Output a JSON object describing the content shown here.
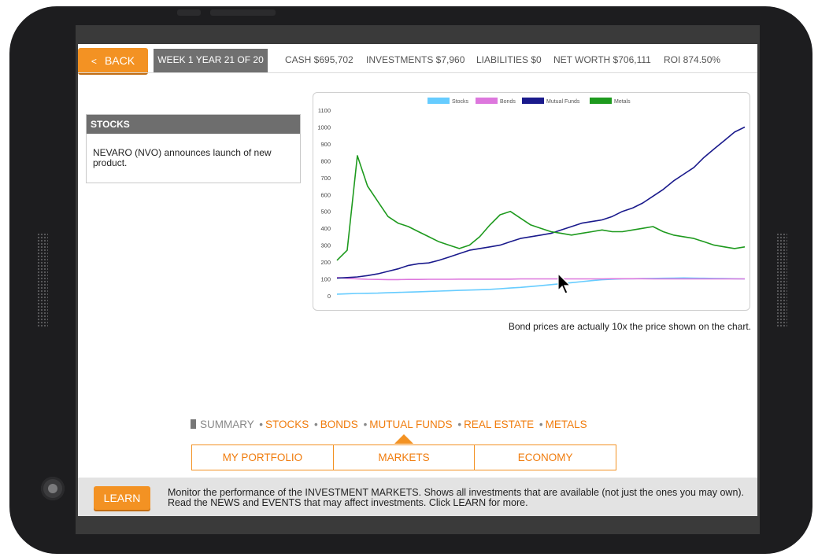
{
  "header": {
    "back_label": "BACK",
    "week_label": "WEEK 1 YEAR 21 OF 20",
    "stats": [
      "CASH $695,702",
      "INVESTMENTS $7,960",
      "LIABILITIES $0",
      "NET WORTH $706,111",
      "ROI 874.50%"
    ]
  },
  "news": {
    "title": "STOCKS",
    "text": "NEVARO (NVO) announces launch of new product."
  },
  "chart_note": "Bond prices are actually 10x the price shown on the chart.",
  "market_nav": {
    "current": "SUMMARY",
    "links": [
      "STOCKS",
      "BONDS",
      "MUTUAL FUNDS",
      "REAL ESTATE",
      "METALS"
    ]
  },
  "tabs": [
    "MY PORTFOLIO",
    "MARKETS",
    "ECONOMY"
  ],
  "footer": {
    "learn_label": "LEARN",
    "text": "Monitor the performance of the INVESTMENT MARKETS. Shows all investments that are available (not just the ones you may own). Read the NEWS and EVENTS that may affect investments. Click LEARN for more."
  },
  "colors": {
    "accent": "#f39223",
    "stocks": "#66ccff",
    "bonds": "#dd77dd",
    "mutual_funds": "#1a1a8c",
    "metals": "#1e9a1e"
  },
  "chart_data": {
    "type": "line",
    "ylim": [
      0,
      1100
    ],
    "yticks": [
      0,
      100,
      200,
      300,
      400,
      500,
      600,
      700,
      800,
      900,
      1000,
      1100
    ],
    "legend_position": "top",
    "grid": false,
    "series": [
      {
        "name": "Stocks",
        "color": "#66ccff",
        "values": [
          10,
          12,
          14,
          15,
          16,
          18,
          20,
          22,
          24,
          26,
          28,
          30,
          32,
          34,
          36,
          38,
          42,
          46,
          50,
          55,
          60,
          66,
          72,
          78,
          84,
          90,
          95,
          98,
          100,
          101,
          102,
          103,
          104,
          105,
          106,
          105,
          104,
          103,
          102,
          101,
          100
        ]
      },
      {
        "name": "Bonds",
        "color": "#dd77dd",
        "values": [
          108,
          104,
          100,
          98,
          97,
          96,
          96,
          97,
          97,
          98,
          98,
          98,
          99,
          99,
          99,
          99,
          99,
          99,
          100,
          100,
          100,
          100,
          100,
          100,
          100,
          100,
          100,
          101,
          101,
          101,
          101,
          100,
          100,
          100,
          100,
          100,
          100,
          100,
          100,
          100,
          100
        ]
      },
      {
        "name": "Mutual Funds",
        "color": "#1a1a8c",
        "values": [
          105,
          108,
          112,
          120,
          130,
          145,
          160,
          180,
          190,
          195,
          210,
          230,
          250,
          270,
          280,
          290,
          300,
          320,
          340,
          350,
          360,
          370,
          390,
          410,
          430,
          440,
          450,
          470,
          500,
          520,
          550,
          590,
          630,
          680,
          720,
          760,
          820,
          870,
          920,
          970,
          1000
        ]
      },
      {
        "name": "Metals",
        "color": "#1e9a1e",
        "values": [
          210,
          270,
          830,
          650,
          560,
          470,
          430,
          410,
          380,
          350,
          320,
          300,
          280,
          300,
          350,
          420,
          480,
          500,
          460,
          420,
          400,
          380,
          370,
          360,
          370,
          380,
          390,
          380,
          380,
          390,
          400,
          410,
          380,
          360,
          350,
          340,
          320,
          300,
          290,
          280,
          290
        ]
      }
    ]
  }
}
